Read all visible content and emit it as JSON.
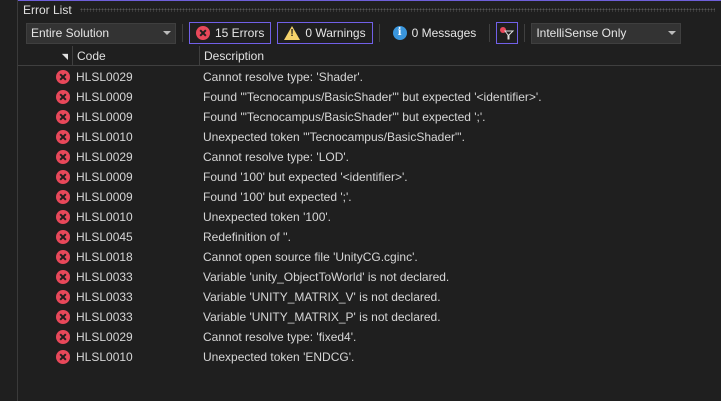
{
  "panel_title": "Error List",
  "toolbar": {
    "scope": "Entire Solution",
    "errors": "15 Errors",
    "warnings": "0 Warnings",
    "messages": "0 Messages",
    "build_filter": "IntelliSense Only"
  },
  "columns": {
    "code": "Code",
    "description": "Description"
  },
  "colors": {
    "accent": "#7160e8",
    "error": "#e8485a"
  },
  "rows": [
    {
      "code": "HLSL0029",
      "desc": "Cannot resolve type: 'Shader'."
    },
    {
      "code": "HLSL0009",
      "desc": "Found '\"Tecnocampus/BasicShader\"' but expected '<identifier>'."
    },
    {
      "code": "HLSL0009",
      "desc": "Found '\"Tecnocampus/BasicShader\"' but expected ';'."
    },
    {
      "code": "HLSL0010",
      "desc": "Unexpected token '\"Tecnocampus/BasicShader\"'."
    },
    {
      "code": "HLSL0029",
      "desc": "Cannot resolve type: 'LOD'."
    },
    {
      "code": "HLSL0009",
      "desc": "Found '100' but expected '<identifier>'."
    },
    {
      "code": "HLSL0009",
      "desc": "Found '100' but expected ';'."
    },
    {
      "code": "HLSL0010",
      "desc": "Unexpected token '100'."
    },
    {
      "code": "HLSL0045",
      "desc": "Redefinition of ''."
    },
    {
      "code": "HLSL0018",
      "desc": "Cannot open source file 'UnityCG.cginc'."
    },
    {
      "code": "HLSL0033",
      "desc": "Variable 'unity_ObjectToWorld' is not declared."
    },
    {
      "code": "HLSL0033",
      "desc": "Variable 'UNITY_MATRIX_V' is not declared."
    },
    {
      "code": "HLSL0033",
      "desc": "Variable 'UNITY_MATRIX_P' is not declared."
    },
    {
      "code": "HLSL0029",
      "desc": "Cannot resolve type: 'fixed4'."
    },
    {
      "code": "HLSL0010",
      "desc": "Unexpected token 'ENDCG'."
    }
  ]
}
